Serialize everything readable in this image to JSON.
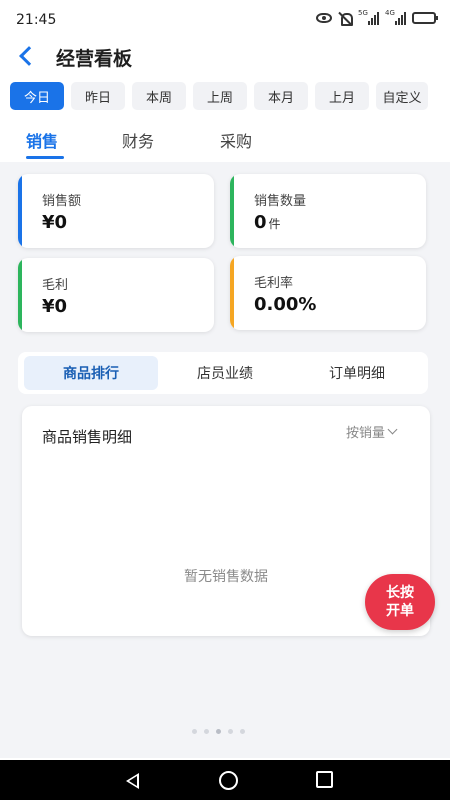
{
  "status_bar": {
    "time": "21:45",
    "network_1": "5G",
    "network_2": "4G"
  },
  "header": {
    "title": "经营看板"
  },
  "periods": [
    {
      "label": "今日",
      "active": true
    },
    {
      "label": "昨日",
      "active": false
    },
    {
      "label": "本周",
      "active": false
    },
    {
      "label": "上周",
      "active": false
    },
    {
      "label": "本月",
      "active": false
    },
    {
      "label": "上月",
      "active": false
    },
    {
      "label": "自定义",
      "active": false
    }
  ],
  "main_tabs": [
    {
      "label": "销售",
      "active": true
    },
    {
      "label": "财务",
      "active": false
    },
    {
      "label": "采购",
      "active": false
    }
  ],
  "stats": {
    "sales_amount": {
      "label": "销售额",
      "value": "¥0",
      "accent": "#1a73e8"
    },
    "sales_qty": {
      "label": "销售数量",
      "value": "0",
      "unit": "件",
      "accent": "#2db55d"
    },
    "gross_profit": {
      "label": "毛利",
      "value": "¥0",
      "accent": "#2db55d"
    },
    "gross_margin": {
      "label": "毛利率",
      "value": "0.00%",
      "accent": "#f5a623"
    }
  },
  "sub_tabs": [
    {
      "label": "商品排行",
      "active": true
    },
    {
      "label": "店员业绩",
      "active": false
    },
    {
      "label": "订单明细",
      "active": false
    }
  ],
  "detail": {
    "title": "商品销售明细",
    "sort_label": "按销量",
    "empty_text": "暂无销售数据"
  },
  "float_button": {
    "line1": "长按",
    "line2": "开单"
  },
  "colors": {
    "primary": "#1a73e8",
    "danger": "#e8364a"
  }
}
